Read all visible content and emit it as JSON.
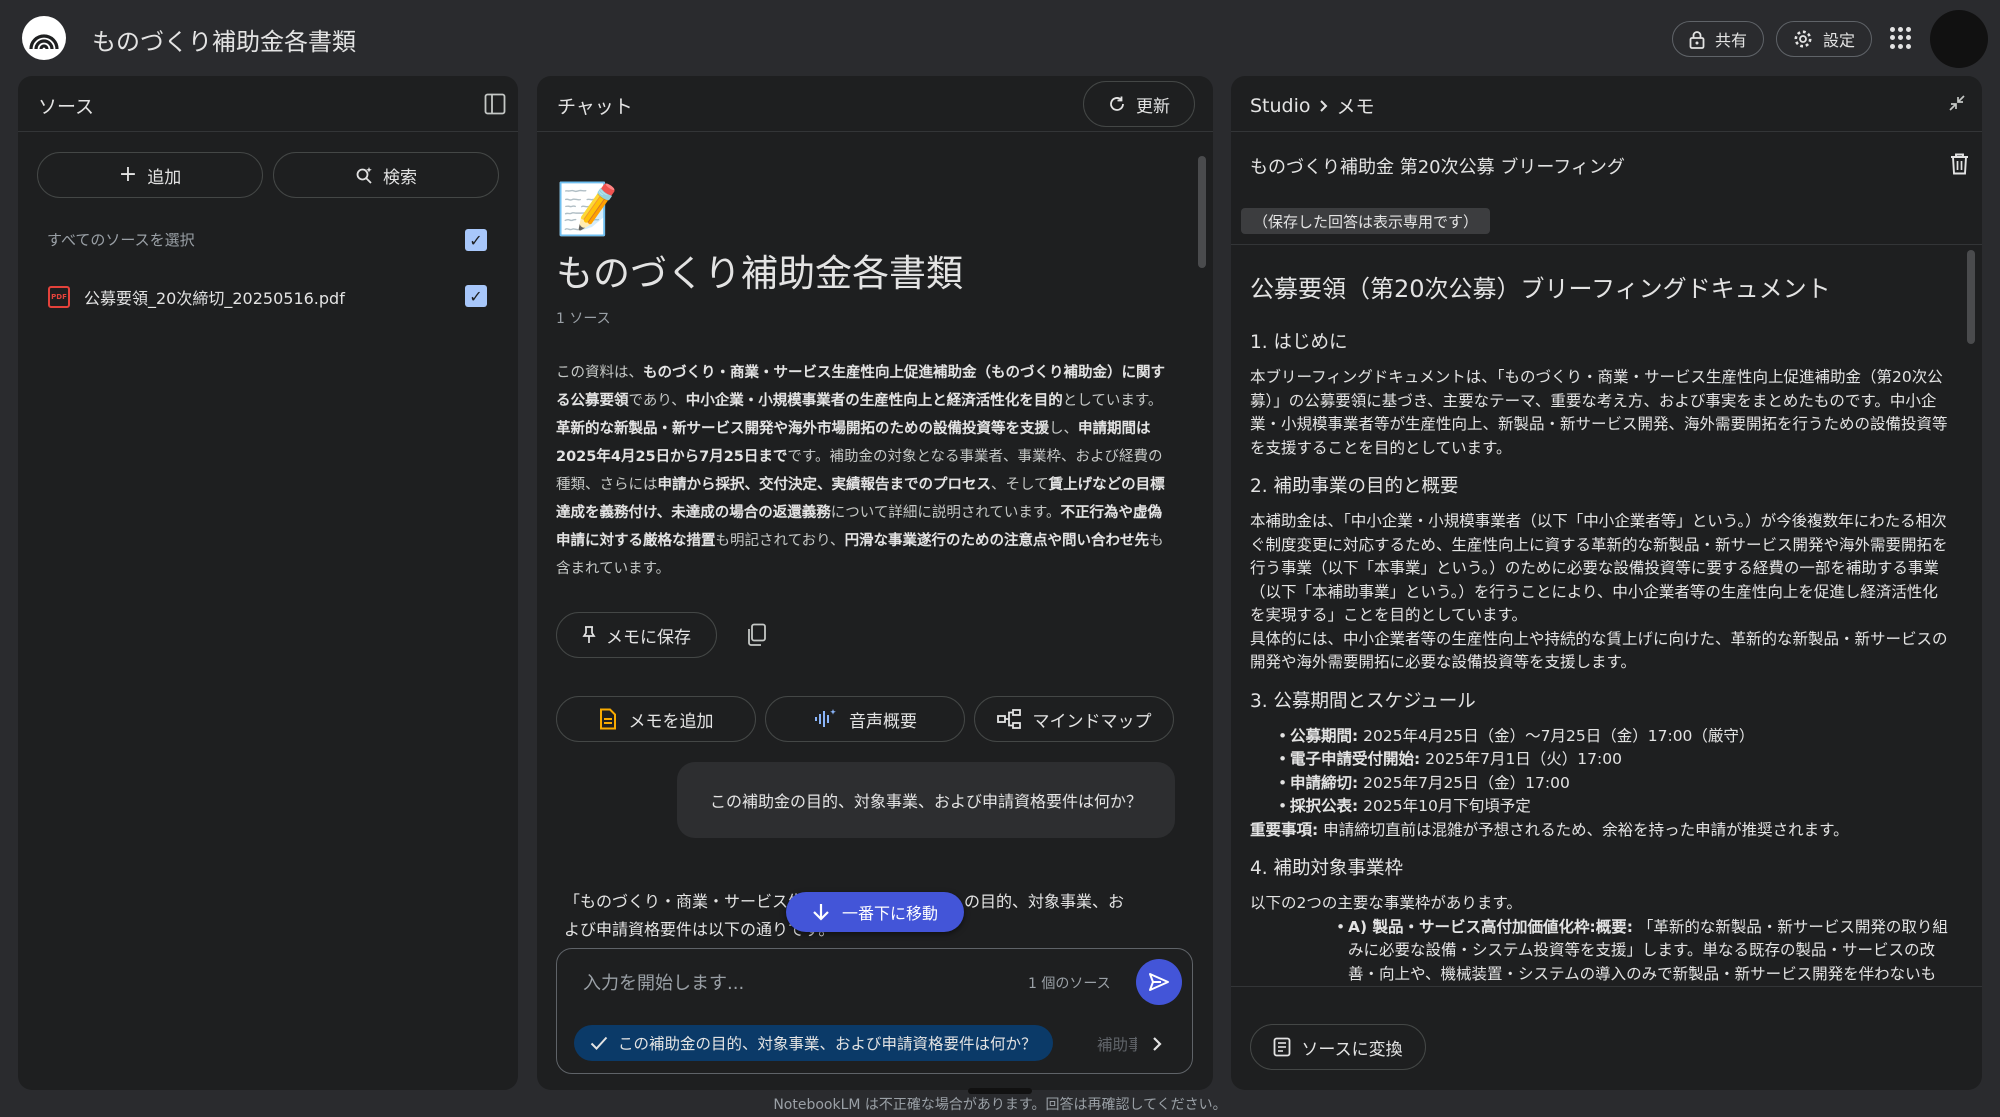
{
  "app": {
    "title": "ものづくり補助金各書類",
    "share_label": "共有",
    "settings_label": "設定"
  },
  "sources_panel": {
    "title": "ソース",
    "add_label": "追加",
    "search_label": "検索",
    "select_all_label": "すべてのソースを選択",
    "sources": [
      {
        "name": "公募要領_20次締切_20250516.pdf",
        "type_badge": "PDF",
        "checked": true
      }
    ]
  },
  "chat_panel": {
    "title": "チャット",
    "refresh_label": "更新",
    "notebook_emoji": "📝",
    "notebook_title": "ものづくり補助金各書類",
    "source_count": "1 ソース",
    "summary": {
      "s1": "この資料は、",
      "b1": "ものづくり・商業・サービス生産性向上促進補助金（ものづくり補助金）に関する公募要領",
      "s2": "であり、",
      "b2": "中小企業・小規模事業者の生産性向上と経済活性化を目的",
      "s3": "としています。",
      "b3": "革新的な新製品・新サービス開発や海外市場開拓のための設備投資等を支援",
      "s4": "し、",
      "b4": "申請期間は2025年4月25日から7月25日まで",
      "s5": "です。補助金の対象となる事業者、事業枠、および経費の種類、さらには",
      "b5": "申請から採択、交付決定、実績報告までのプロセス",
      "s6": "、そして",
      "b6": "賃上げなどの目標達成を義務付け、未達成の場合の返還義務",
      "s7": "について詳細に説明されています。",
      "b7": "不正行為や虚偽申請に対する厳格な措置",
      "s8": "も明記されており、",
      "b8": "円滑な事業遂行のための注意点や問い合わせ先",
      "s9": "も含まれています。"
    },
    "save_memo_label": "メモに保存",
    "add_memo_label": "メモを追加",
    "audio_overview_label": "音声概要",
    "mindmap_label": "マインドマップ",
    "user_question": "この補助金の目的、対象事業、および申請資格要件は何か？",
    "answer_partial": "「ものづくり・商業・サービス生産性向上促進補助金」の目的、対象事業、および申請資格要件は以下の通りです。",
    "scroll_bottom_label": "一番下に移動",
    "input_placeholder": "入力を開始します...",
    "input_source_count": "1 個のソース",
    "suggestions": [
      "この補助金の目的、対象事業、および申請資格要件は何か？",
      "補助事"
    ],
    "disclaimer": "NotebookLM は不正確な場合があります。回答は再確認してください。"
  },
  "studio_panel": {
    "breadcrumb_root": "Studio",
    "breadcrumb_current": "メモ",
    "memo_title": "ものづくり補助金 第20次公募 ブリーフィング",
    "readonly_note": "（保存した回答は表示専用です）",
    "doc": {
      "h1": "公募要領（第20次公募）ブリーフィングドキュメント",
      "sec1_title": "1. はじめに",
      "sec1_body": "本ブリーフィングドキュメントは、「ものづくり・商業・サービス生産性向上促進補助金（第20次公募）」の公募要領に基づき、主要なテーマ、重要な考え方、および事実をまとめたものです。中小企業・小規模事業者等が生産性向上、新製品・新サービス開発、海外需要開拓を行うための設備投資等を支援することを目的としています。",
      "sec2_title": "2. 補助事業の目的と概要",
      "sec2_body1": "本補助金は、「中小企業・小規模事業者（以下「中小企業者等」という。）が今後複数年にわたる相次ぐ制度変更に対応するため、生産性向上に資する革新的な新製品・新サービス開発や海外需要開拓を行う事業（以下「本事業」という。）のために必要な設備投資等に要する経費の一部を補助する事業（以下「本補助事業」という。）を行うことにより、中小企業者等の生産性向上を促進し経済活性化を実現する」ことを目的としています。",
      "sec2_body2": "具体的には、中小企業者等の生産性向上や持続的な賃上げに向けた、革新的な新製品・新サービスの開発や海外需要開拓に必要な設備投資等を支援します。",
      "sec3_title": "3. 公募期間とスケジュール",
      "schedule": [
        {
          "label": "公募期間:",
          "value": " 2025年4月25日（金）〜7月25日（金）17:00（厳守）"
        },
        {
          "label": "電子申請受付開始:",
          "value": " 2025年7月1日（火）17:00"
        },
        {
          "label": "申請締切:",
          "value": " 2025年7月25日（金）17:00"
        },
        {
          "label": "採択公表:",
          "value": " 2025年10月下旬頃予定"
        }
      ],
      "important_label": "重要事項:",
      "important_text": " 申請締切直前は混雑が予想されるため、余裕を持った申請が推奨されます。",
      "sec4_title": "4. 補助対象事業枠",
      "sec4_intro": "以下の2つの主要な事業枠があります。",
      "frame_a_label": "A) 製品・サービス高付加価値化枠:",
      "frame_a_sub": "概要:",
      "frame_a_text": " 「革新的な新製品・新サービス開発の取り組みに必要な設備・システム投資等を支援」します。単なる既存の製品・サービスの改善・向上や、機械装置・システムの導入のみで新製品・新サービス開発を伴わないものは対象外です。また、「業種ごとに同業の中小企業者等（地域性"
    },
    "convert_label": "ソースに変換"
  }
}
